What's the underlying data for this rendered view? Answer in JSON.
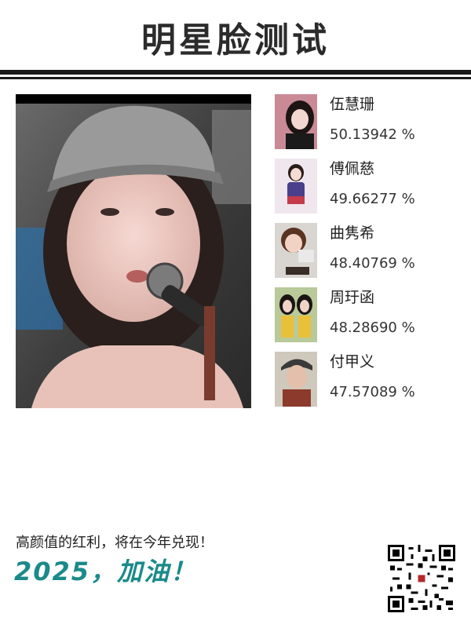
{
  "header": {
    "title": "明星脸测试"
  },
  "matches": [
    {
      "name": "伍慧珊",
      "score": "50.13942 %"
    },
    {
      "name": "傅佩慈",
      "score": "49.66277 %"
    },
    {
      "name": "曲隽希",
      "score": "48.40769 %"
    },
    {
      "name": "周玗函",
      "score": "48.28690 %"
    },
    {
      "name": "付甲义",
      "score": "47.57089 %"
    }
  ],
  "footer": {
    "slogan": "高颜值的红利，将在今年兑现！",
    "tagline": "2025，加油！"
  },
  "colors": {
    "accent": "#1b8a8a",
    "rule": "#1a1a1a"
  }
}
